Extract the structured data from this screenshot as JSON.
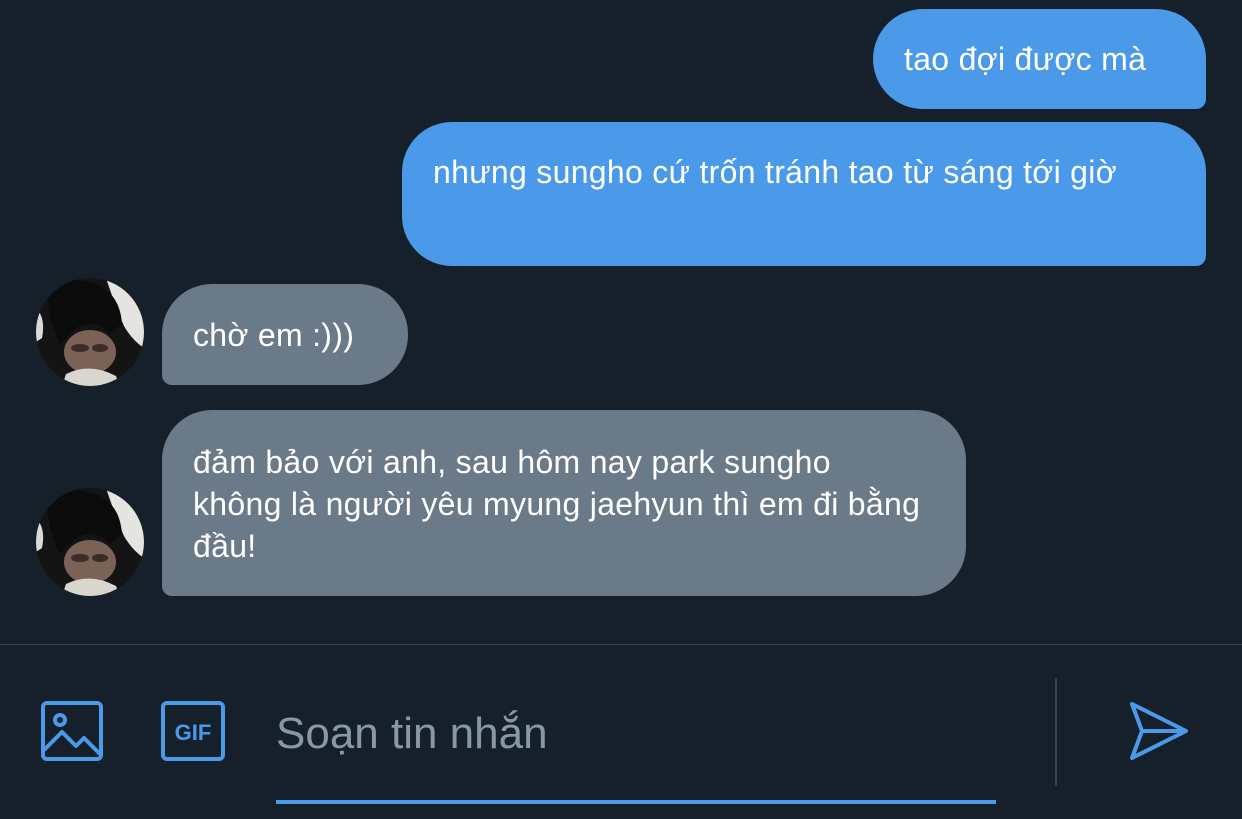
{
  "conversation": {
    "messages": [
      {
        "direction": "sent",
        "text": "tao đợi được mà"
      },
      {
        "direction": "sent",
        "text": "nhưng sungho cứ trốn tránh tao từ sáng tới giờ"
      },
      {
        "direction": "received",
        "text": "chờ em :)))"
      },
      {
        "direction": "received",
        "text": "đảm bảo với anh, sau hôm nay park sungho không là người yêu myung jaehyun thì em đi bằng đầu!"
      }
    ]
  },
  "composer": {
    "placeholder": "Soạn tin nhắn",
    "value": "",
    "image_icon": "image-icon",
    "gif_icon": "gif-icon",
    "gif_label": "GIF",
    "send_icon": "send-icon"
  },
  "colors": {
    "background": "#15202b",
    "sent_bubble": "#4a9ae9",
    "received_bubble": "#6b7a89",
    "accent": "#4a9ae9",
    "placeholder": "#8899a6"
  }
}
